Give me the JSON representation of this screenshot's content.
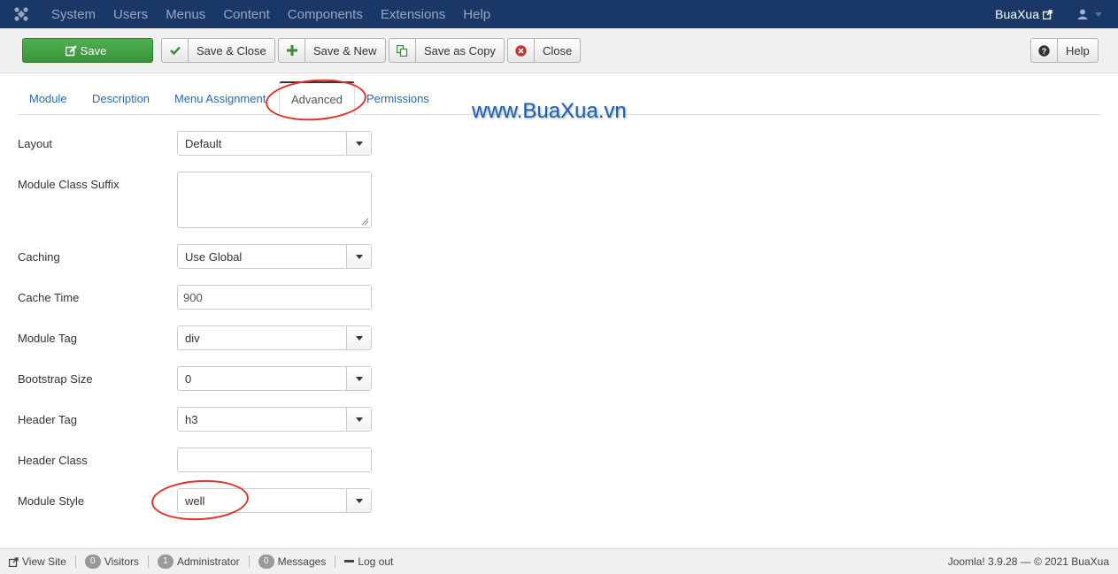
{
  "navbar": {
    "menu": [
      "System",
      "Users",
      "Menus",
      "Content",
      "Components",
      "Extensions",
      "Help"
    ],
    "site_name": "BuaXua",
    "bg_color": "#1a3867"
  },
  "toolbar": {
    "save_label": "Save",
    "save_close_label": "Save & Close",
    "save_new_label": "Save & New",
    "save_copy_label": "Save as Copy",
    "close_label": "Close",
    "help_label": "Help",
    "save_color": "#46a546"
  },
  "tabs": [
    "Module",
    "Description",
    "Menu Assignment",
    "Advanced",
    "Permissions"
  ],
  "active_tab": "Advanced",
  "watermark": "www.BuaXua.vn",
  "form": {
    "layout": {
      "label": "Layout",
      "value": "Default"
    },
    "class_suffix": {
      "label": "Module Class Suffix",
      "value": ""
    },
    "caching": {
      "label": "Caching",
      "value": "Use Global"
    },
    "cache_time": {
      "label": "Cache Time",
      "value": "900"
    },
    "module_tag": {
      "label": "Module Tag",
      "value": "div"
    },
    "bootstrap_size": {
      "label": "Bootstrap Size",
      "value": "0"
    },
    "header_tag": {
      "label": "Header Tag",
      "value": "h3"
    },
    "header_class": {
      "label": "Header Class",
      "value": ""
    },
    "module_style": {
      "label": "Module Style",
      "value": "well"
    }
  },
  "statusbar": {
    "view_site": "View Site",
    "visitors_count": "0",
    "visitors_label": "Visitors",
    "admin_count": "1",
    "admin_label": "Administrator",
    "messages_count": "0",
    "messages_label": "Messages",
    "logout": "Log out",
    "version": "Joomla! 3.9.28 — © 2021 BuaXua"
  }
}
